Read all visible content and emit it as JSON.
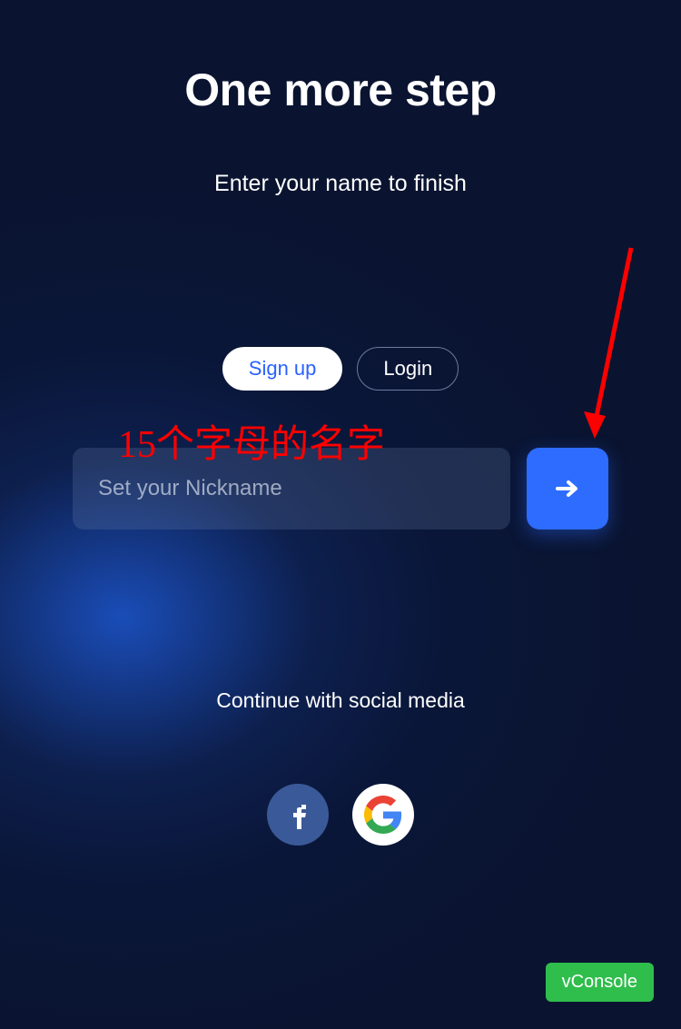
{
  "header": {
    "title": "One more step",
    "subtitle": "Enter your name to finish"
  },
  "tabs": {
    "signup": "Sign up",
    "login": "Login"
  },
  "form": {
    "nickname_placeholder": "Set your Nickname",
    "nickname_value": ""
  },
  "social": {
    "label": "Continue with social media"
  },
  "annotation": {
    "text": "15个字母的名字"
  },
  "vconsole": {
    "label": "vConsole"
  },
  "colors": {
    "accent": "#2d6cff",
    "annotation_red": "#ff0000",
    "vconsole_green": "#2fbd4c"
  }
}
